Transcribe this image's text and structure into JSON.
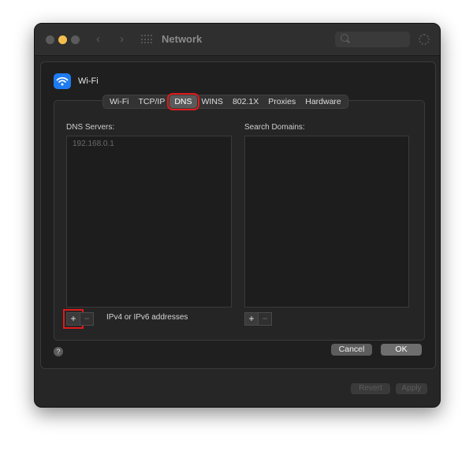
{
  "window": {
    "title": "Network"
  },
  "interface": {
    "name": "Wi-Fi"
  },
  "tabs": [
    {
      "label": "Wi-Fi"
    },
    {
      "label": "TCP/IP"
    },
    {
      "label": "DNS"
    },
    {
      "label": "WINS"
    },
    {
      "label": "802.1X"
    },
    {
      "label": "Proxies"
    },
    {
      "label": "Hardware"
    }
  ],
  "active_tab": "DNS",
  "dns": {
    "servers_label": "DNS Servers:",
    "servers": [
      "192.168.0.1"
    ],
    "domains_label": "Search Domains:",
    "domains": [],
    "add_label": "+",
    "remove_label": "−",
    "hint": "IPv4 or IPv6 addresses"
  },
  "footer": {
    "help_label": "?",
    "cancel_label": "Cancel",
    "ok_label": "OK"
  },
  "window_footer": {
    "revert_label": "Revert",
    "apply_label": "Apply"
  },
  "colors": {
    "highlight": "#e01a1a",
    "wifi_badge": "#1e7cf2"
  },
  "icons": [
    "wifi-icon",
    "search-icon",
    "gear-icon",
    "grid-icon",
    "back-arrow-icon",
    "forward-arrow-icon"
  ]
}
